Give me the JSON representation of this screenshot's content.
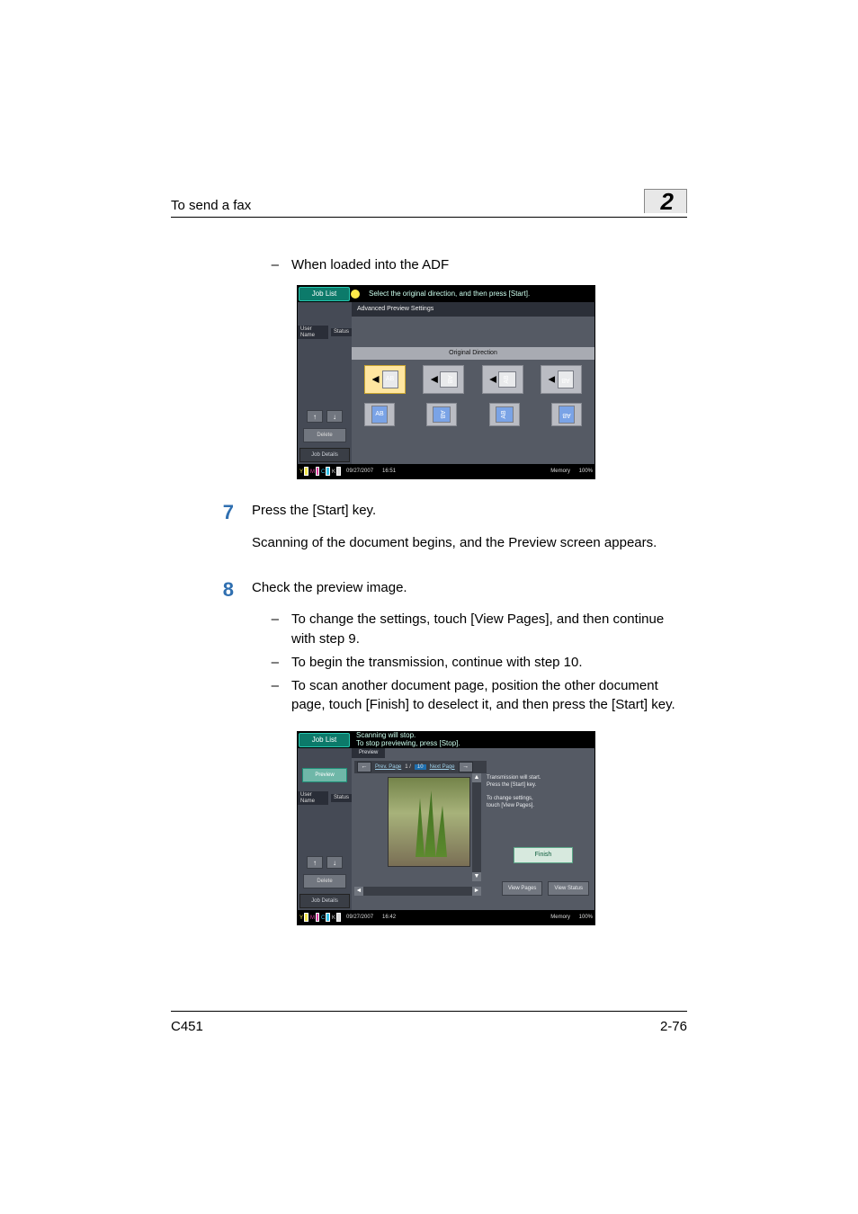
{
  "header": {
    "title": "To send a fax",
    "chapter": "2"
  },
  "intro_bullet": "When loaded into the ADF",
  "steps": {
    "s7": {
      "no": "7",
      "line1": "Press the [Start] key.",
      "line2": "Scanning of the document begins, and the Preview screen appears."
    },
    "s8": {
      "no": "8",
      "line1": "Check the preview image.",
      "b1": "To change the settings, touch [View Pages], and then continue with step 9.",
      "b2": "To begin the transmission, continue with step 10.",
      "b3": "To scan another document page, position the other document page, touch [Finish] to deselect it, and then press the [Start] key."
    }
  },
  "shot1": {
    "joblist": "Job List",
    "topmsg": "Select the original direction, and then press [Start].",
    "subhdr": "Advanced Preview Settings",
    "username": "User Name",
    "status": "Status",
    "delete": "Delete",
    "jobdetails": "Job Details",
    "odlabel": "Original Direction",
    "pg_ab": "AB",
    "date": "09/27/2007",
    "time": "16:51",
    "memory": "Memory",
    "mempct": "100%"
  },
  "shot2": {
    "joblist": "Job List",
    "topmsg1": "Scanning will stop.",
    "topmsg2": "To stop previewing, press [Stop].",
    "preview_btn": "Preview",
    "preview_tab": "Preview",
    "usern": "User Name",
    "status": "Status",
    "delete": "Delete",
    "jobdetails": "Job Details",
    "prev_page": "Prev. Page",
    "next_page": "Next Page",
    "page_cur": "1 /",
    "page_total": "10",
    "info1": "Transmission will start.",
    "info2": "Press the [Start] key.",
    "info3": "To change settings,",
    "info4": "touch [View Pages].",
    "finish": "Finish",
    "viewpages": "View Pages",
    "viewstatus": "View Status",
    "date": "09/27/2007",
    "time": "16:42",
    "memory": "Memory",
    "mempct": "100%"
  },
  "footer": {
    "left": "C451",
    "right": "2-76"
  }
}
